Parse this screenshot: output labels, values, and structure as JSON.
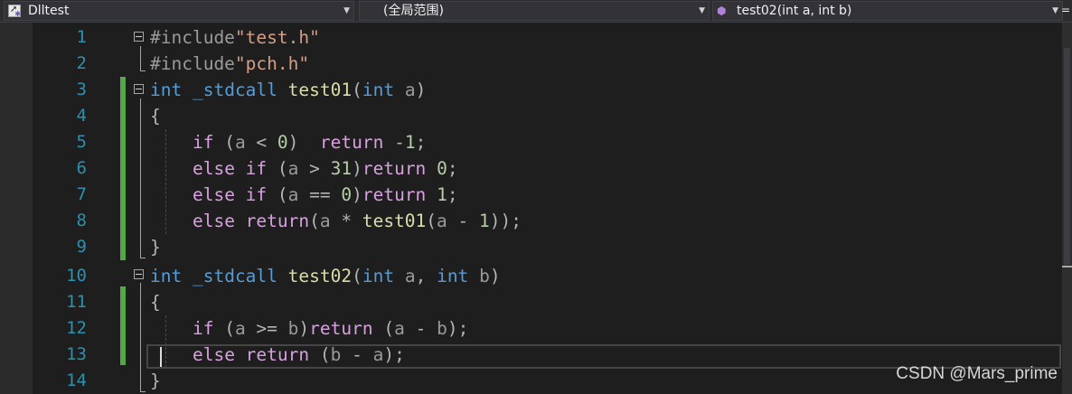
{
  "nav": {
    "project": "Dlltest",
    "scope": "(全局范围)",
    "member": "test02(int a, int b)",
    "project_icon": "vc-project-icon",
    "member_icon": "cube-member-icon",
    "chevron_glyph": "▼",
    "split_glyph": "="
  },
  "line_numbers": [
    "1",
    "2",
    "3",
    "4",
    "5",
    "6",
    "7",
    "8",
    "9",
    "10",
    "11",
    "12",
    "13",
    "14"
  ],
  "code_lines": [
    [
      {
        "t": "#include",
        "c": "preprocessor"
      },
      {
        "t": "\"test.h\"",
        "c": "string"
      }
    ],
    [
      {
        "t": "#include",
        "c": "preprocessor"
      },
      {
        "t": "\"pch.h\"",
        "c": "string"
      }
    ],
    [
      {
        "t": "int",
        "c": "keyword"
      },
      {
        "t": " ",
        "c": "plain"
      },
      {
        "t": "_stdcall",
        "c": "keyword"
      },
      {
        "t": " ",
        "c": "plain"
      },
      {
        "t": "test01",
        "c": "function"
      },
      {
        "t": "(",
        "c": "punct"
      },
      {
        "t": "int",
        "c": "keyword"
      },
      {
        "t": " ",
        "c": "plain"
      },
      {
        "t": "a",
        "c": "param"
      },
      {
        "t": ")",
        "c": "punct"
      }
    ],
    [
      {
        "t": "{",
        "c": "punct"
      }
    ],
    [
      {
        "t": "    ",
        "c": "plain"
      },
      {
        "t": "if",
        "c": "control"
      },
      {
        "t": " (",
        "c": "punct"
      },
      {
        "t": "a",
        "c": "param"
      },
      {
        "t": " < ",
        "c": "punct"
      },
      {
        "t": "0",
        "c": "number"
      },
      {
        "t": ")  ",
        "c": "punct"
      },
      {
        "t": "return",
        "c": "control"
      },
      {
        "t": " -",
        "c": "punct"
      },
      {
        "t": "1",
        "c": "number"
      },
      {
        "t": ";",
        "c": "punct"
      }
    ],
    [
      {
        "t": "    ",
        "c": "plain"
      },
      {
        "t": "else if",
        "c": "control"
      },
      {
        "t": " (",
        "c": "punct"
      },
      {
        "t": "a",
        "c": "param"
      },
      {
        "t": " > ",
        "c": "punct"
      },
      {
        "t": "31",
        "c": "number"
      },
      {
        "t": ")",
        "c": "punct"
      },
      {
        "t": "return",
        "c": "control"
      },
      {
        "t": " ",
        "c": "plain"
      },
      {
        "t": "0",
        "c": "number"
      },
      {
        "t": ";",
        "c": "punct"
      }
    ],
    [
      {
        "t": "    ",
        "c": "plain"
      },
      {
        "t": "else if",
        "c": "control"
      },
      {
        "t": " (",
        "c": "punct"
      },
      {
        "t": "a",
        "c": "param"
      },
      {
        "t": " == ",
        "c": "punct"
      },
      {
        "t": "0",
        "c": "number"
      },
      {
        "t": ")",
        "c": "punct"
      },
      {
        "t": "return",
        "c": "control"
      },
      {
        "t": " ",
        "c": "plain"
      },
      {
        "t": "1",
        "c": "number"
      },
      {
        "t": ";",
        "c": "punct"
      }
    ],
    [
      {
        "t": "    ",
        "c": "plain"
      },
      {
        "t": "else return",
        "c": "control"
      },
      {
        "t": "(",
        "c": "punct"
      },
      {
        "t": "a",
        "c": "param"
      },
      {
        "t": " * ",
        "c": "punct"
      },
      {
        "t": "test01",
        "c": "function"
      },
      {
        "t": "(",
        "c": "punct"
      },
      {
        "t": "a",
        "c": "param"
      },
      {
        "t": " - ",
        "c": "punct"
      },
      {
        "t": "1",
        "c": "number"
      },
      {
        "t": "));",
        "c": "punct"
      }
    ],
    [
      {
        "t": "}",
        "c": "punct"
      }
    ],
    [
      {
        "t": "int",
        "c": "keyword"
      },
      {
        "t": " ",
        "c": "plain"
      },
      {
        "t": "_stdcall",
        "c": "keyword"
      },
      {
        "t": " ",
        "c": "plain"
      },
      {
        "t": "test02",
        "c": "function"
      },
      {
        "t": "(",
        "c": "punct"
      },
      {
        "t": "int",
        "c": "keyword"
      },
      {
        "t": " ",
        "c": "plain"
      },
      {
        "t": "a",
        "c": "param"
      },
      {
        "t": ", ",
        "c": "punct"
      },
      {
        "t": "int",
        "c": "keyword"
      },
      {
        "t": " ",
        "c": "plain"
      },
      {
        "t": "b",
        "c": "param"
      },
      {
        "t": ")",
        "c": "punct"
      }
    ],
    [
      {
        "t": "{",
        "c": "punct"
      }
    ],
    [
      {
        "t": "    ",
        "c": "plain"
      },
      {
        "t": "if",
        "c": "control"
      },
      {
        "t": " (",
        "c": "punct"
      },
      {
        "t": "a",
        "c": "param"
      },
      {
        "t": " >= ",
        "c": "punct"
      },
      {
        "t": "b",
        "c": "param"
      },
      {
        "t": ")",
        "c": "punct"
      },
      {
        "t": "return",
        "c": "control"
      },
      {
        "t": " (",
        "c": "punct"
      },
      {
        "t": "a",
        "c": "param"
      },
      {
        "t": " - ",
        "c": "punct"
      },
      {
        "t": "b",
        "c": "param"
      },
      {
        "t": ");",
        "c": "punct"
      }
    ],
    [
      {
        "t": "    ",
        "c": "plain"
      },
      {
        "t": "else return",
        "c": "control"
      },
      {
        "t": " (",
        "c": "punct"
      },
      {
        "t": "b",
        "c": "param"
      },
      {
        "t": " - ",
        "c": "punct"
      },
      {
        "t": "a",
        "c": "param"
      },
      {
        "t": ");",
        "c": "punct"
      }
    ],
    [
      {
        "t": "}",
        "c": "punct"
      }
    ]
  ],
  "colors": {
    "editor_bg": "#1e1e1e",
    "line_number": "#2b91af",
    "keyword": "#569cd6",
    "control_keyword": "#d8a0df",
    "function": "#dcdcaa",
    "string": "#d69d85",
    "number": "#b5cea8",
    "change_bar": "#57a64a"
  },
  "watermark": "CSDN @Mars_prime"
}
